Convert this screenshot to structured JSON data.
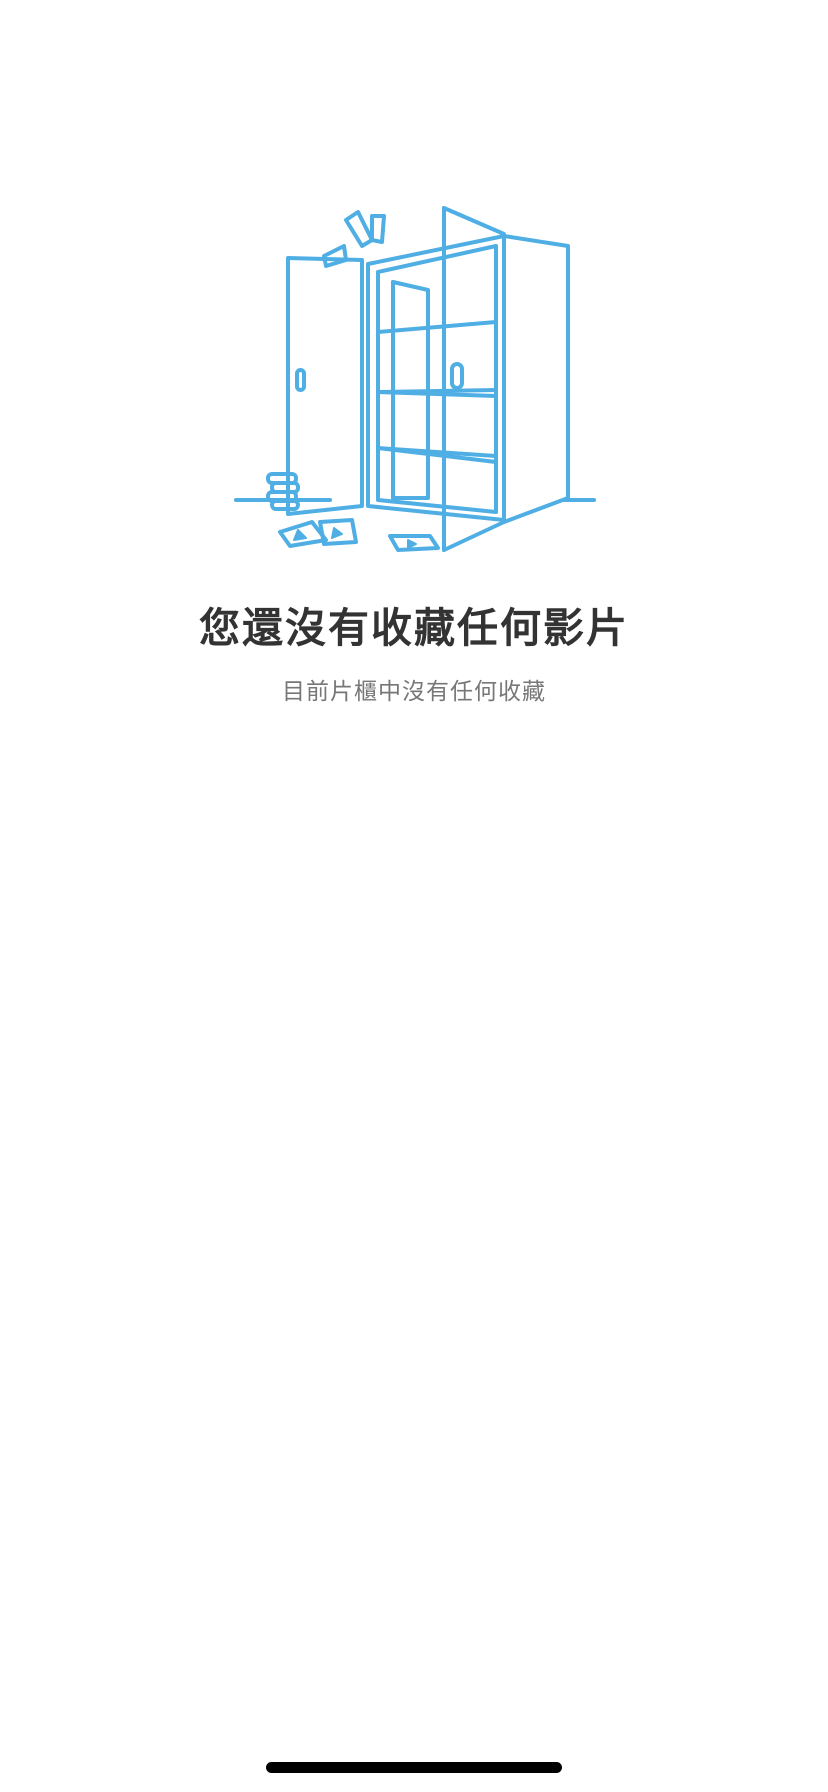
{
  "empty_state": {
    "illustration_icon": "open-cabinet-illustration",
    "title": "您還沒有收藏任何影片",
    "subtitle": "目前片櫃中沒有任何收藏"
  },
  "colors": {
    "illustration_stroke": "#4FAEE3",
    "title": "#333333",
    "subtitle": "#777777",
    "background": "#FFFFFF"
  }
}
